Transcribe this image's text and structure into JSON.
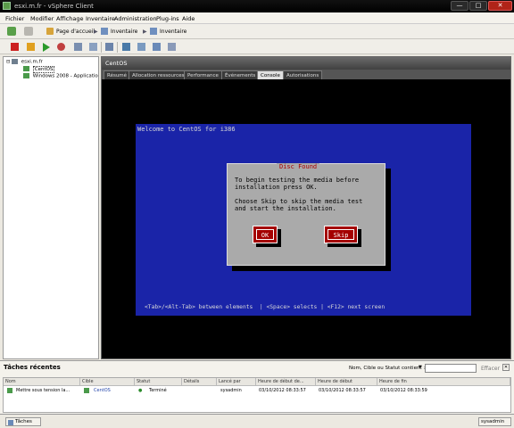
{
  "window": {
    "title": "esxi.m.fr - vSphere Client",
    "controls": {
      "minimize": "—",
      "maximize": "□",
      "close": "✕"
    }
  },
  "menu": [
    "Fichier",
    "Modifier",
    "Affichage",
    "Inventaire",
    "Administration",
    "Plug-ins",
    "Aide"
  ],
  "nav": {
    "breadcrumbs": [
      "Page d'accueil",
      "Inventaire",
      "Inventaire"
    ]
  },
  "tree": {
    "host": "esxi.m.fr",
    "vms": [
      "CentOS",
      "Windows 2008 - Applicatio"
    ]
  },
  "vm_panel": {
    "title": "CentOS",
    "tabs": [
      "Résumé",
      "Allocation ressources",
      "Performance",
      "Événements",
      "Console",
      "Autorisations"
    ],
    "active_tab": 4
  },
  "console": {
    "welcome": "Welcome to CentOS for i386",
    "dialog": {
      "title": "Disc Found",
      "line1": "To begin testing the media before",
      "line2": "installation press OK.",
      "line3": "Choose Skip to skip the media test",
      "line4": "and start the installation.",
      "ok": "OK",
      "skip": "Skip"
    },
    "footer": "<Tab>/<Alt-Tab> between elements  | <Space> selects | <F12> next screen"
  },
  "recent_tasks": {
    "title": "Tâches récentes",
    "filter_label": "Nom, Cible ou Statut contient :",
    "filter_value": "",
    "clear_label": "Effacer",
    "columns": [
      "Nom",
      "Cible",
      "Statut",
      "Détails",
      "Lancé par",
      "Heure de début de...",
      "Heure de début",
      "Heure de fin"
    ],
    "rows": [
      {
        "name": "Mettre sous tension la...",
        "target": "CentOS",
        "status": "Terminé",
        "details": "",
        "initiator": "sysadmin",
        "requested": "03/10/2012 08:33:57",
        "start": "03/10/2012 08:33:57",
        "end": "03/10/2012 08:33:59"
      }
    ]
  },
  "statusbar": {
    "tasks_button": "Tâches",
    "user": "sysadmin"
  },
  "colors": {
    "console_blue": "#1a24a8",
    "dialog_gray": "#aaaaaa",
    "button_red": "#a40000",
    "dialog_title_red": "#aa0000"
  }
}
